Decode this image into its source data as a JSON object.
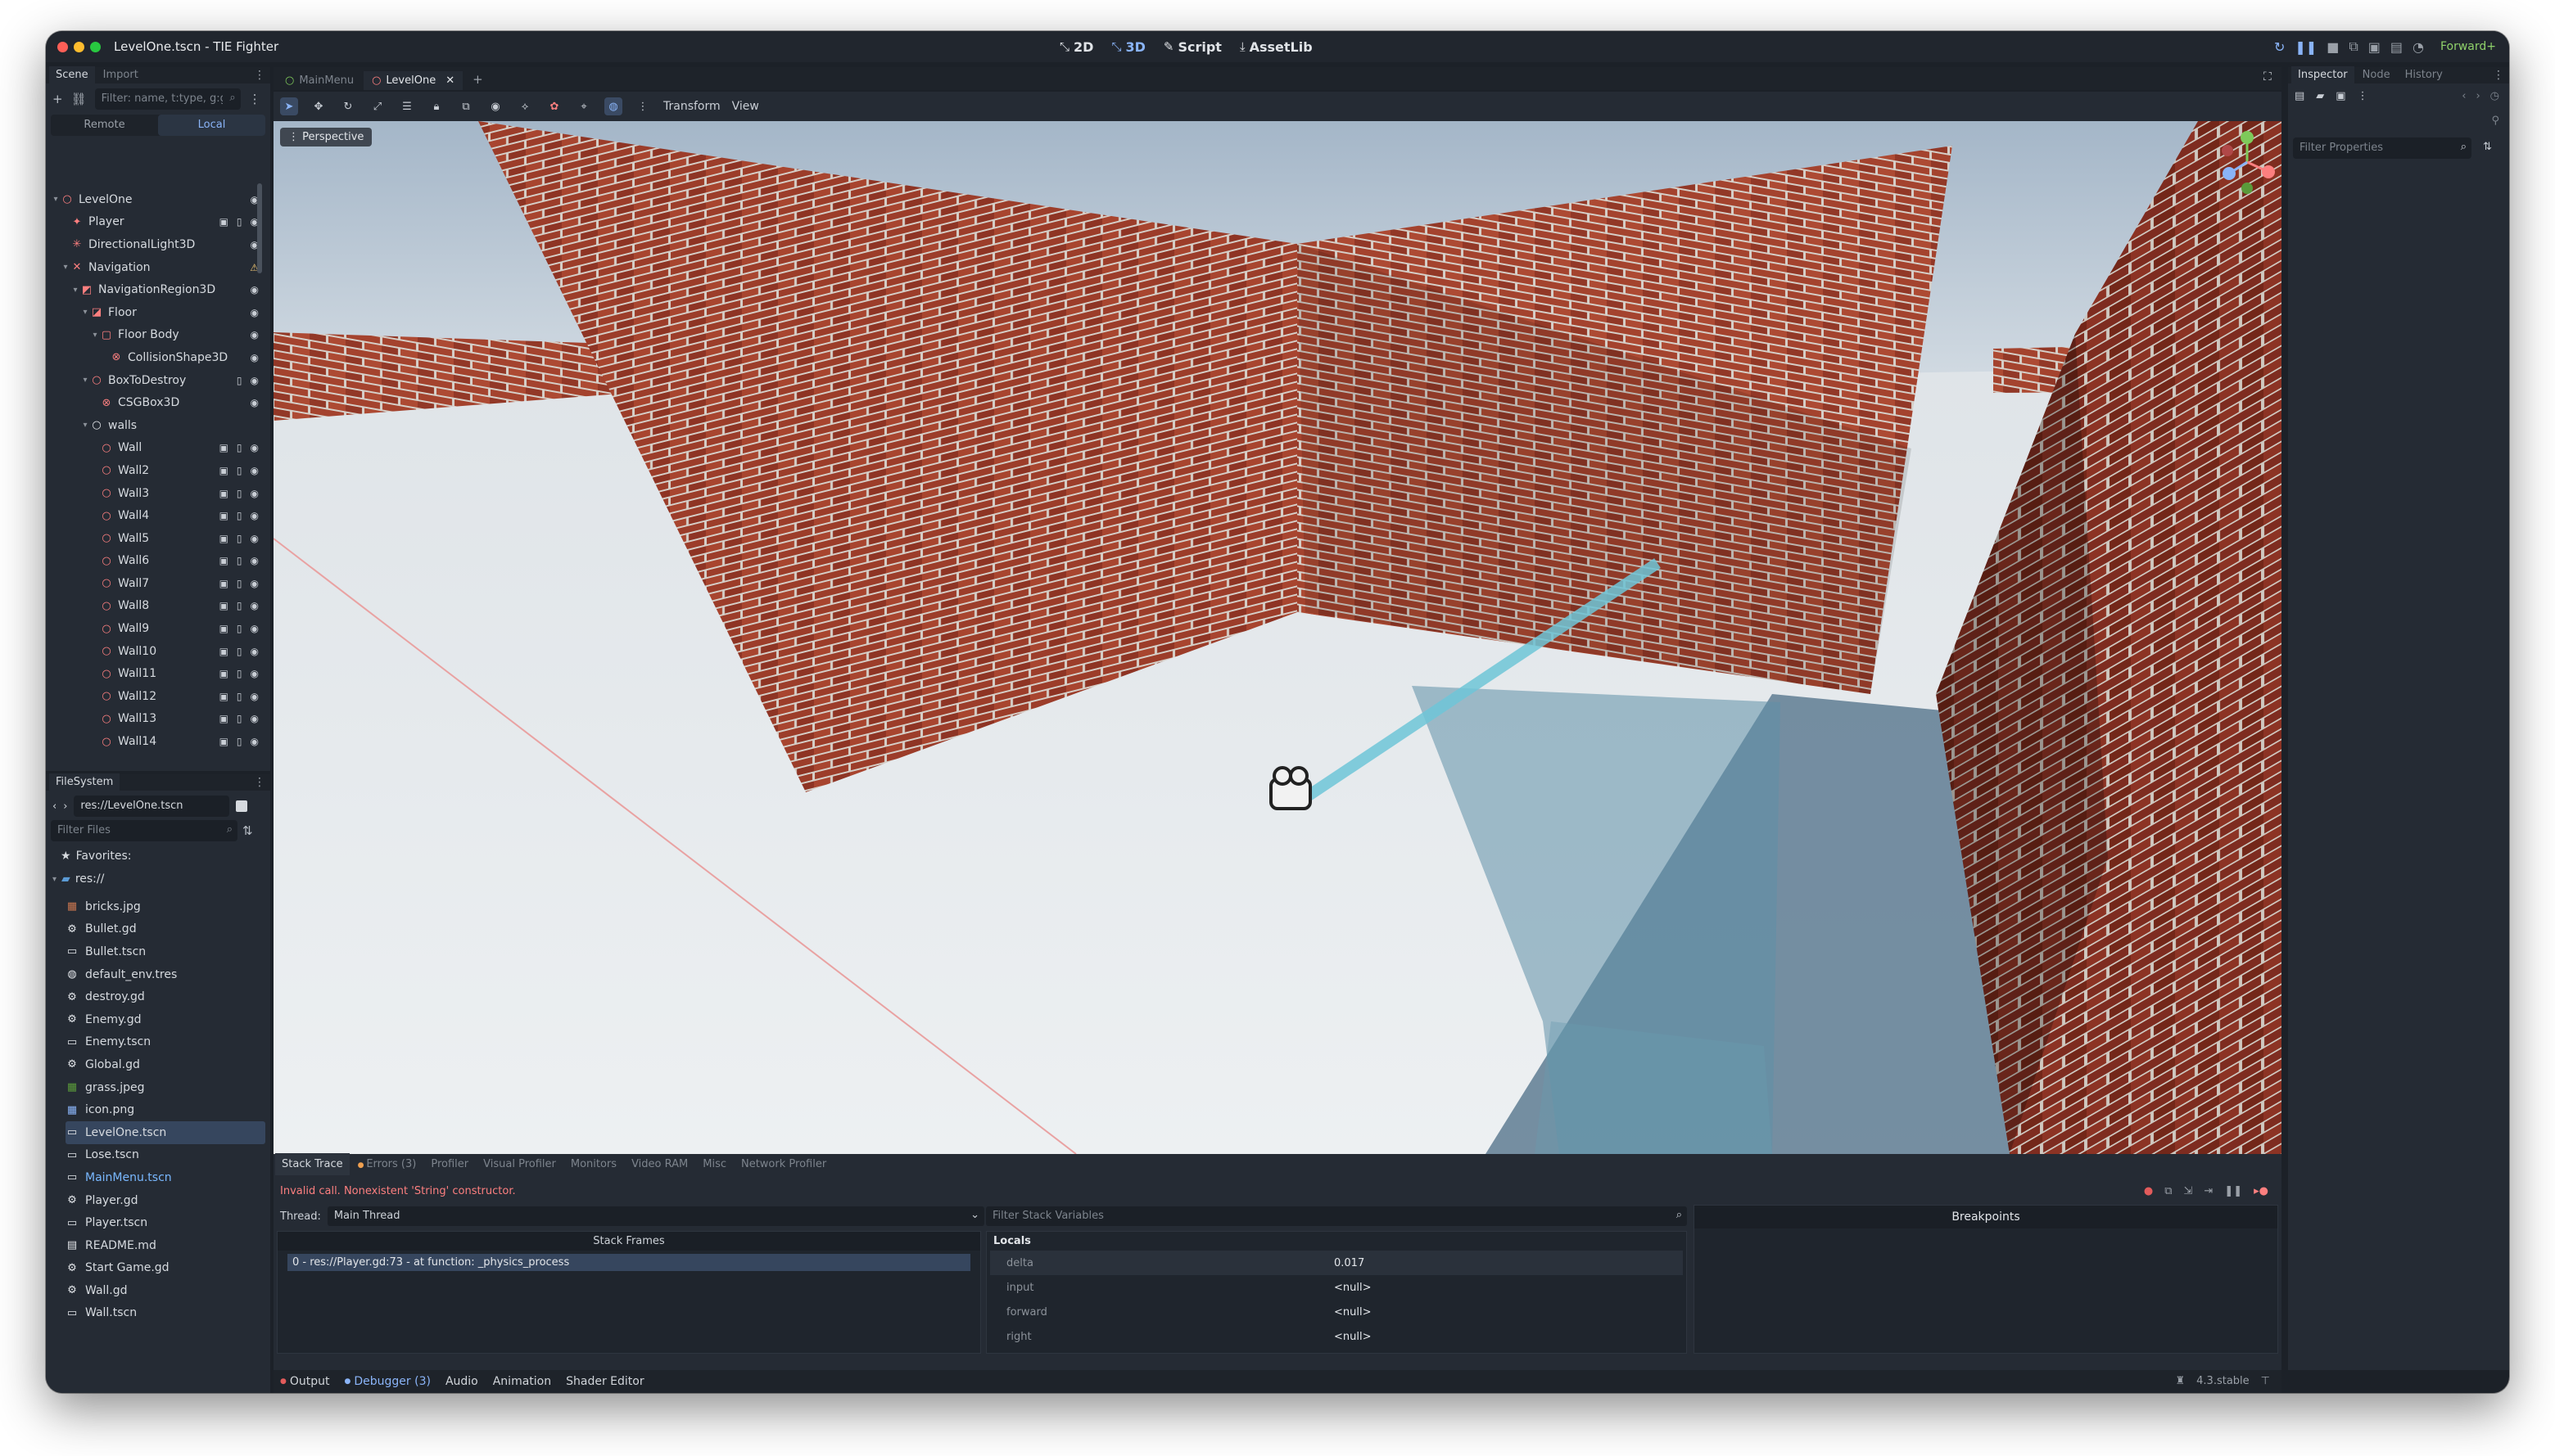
{
  "window": {
    "title": "LevelOne.tscn - TIE Fighter"
  },
  "workspaces": [
    {
      "glyph": "⤡",
      "label": "2D",
      "active": false
    },
    {
      "glyph": "⤡",
      "label": "3D",
      "active": true
    },
    {
      "glyph": "✎",
      "label": "Script",
      "active": false
    },
    {
      "glyph": "⤓",
      "label": "AssetLib",
      "active": false
    }
  ],
  "renderer": "Forward+",
  "scene_dock": {
    "tabs": [
      "Scene",
      "Import"
    ],
    "filter_placeholder": "Filter: name, t:type, g:group",
    "remote": "Remote",
    "local": "Local",
    "tree": [
      {
        "label": "LevelOne",
        "depth": 0,
        "arrow": "▾",
        "icon": "○",
        "color": "red",
        "eye": true,
        "script": false,
        "group": false,
        "warn": false
      },
      {
        "label": "Player",
        "depth": 1,
        "arrow": "",
        "icon": "✦",
        "color": "red",
        "eye": true,
        "script": true,
        "group": true,
        "warn": false
      },
      {
        "label": "DirectionalLight3D",
        "depth": 1,
        "arrow": "",
        "icon": "✳",
        "color": "red",
        "eye": true,
        "script": false,
        "group": false,
        "warn": false
      },
      {
        "label": "Navigation",
        "depth": 1,
        "arrow": "▾",
        "icon": "✕",
        "color": "red",
        "eye": false,
        "script": false,
        "group": false,
        "warn": true
      },
      {
        "label": "NavigationRegion3D",
        "depth": 2,
        "arrow": "▾",
        "icon": "◩",
        "color": "red",
        "eye": true,
        "script": false,
        "group": false,
        "warn": false
      },
      {
        "label": "Floor",
        "depth": 3,
        "arrow": "▾",
        "icon": "◪",
        "color": "red",
        "eye": true,
        "script": false,
        "group": false,
        "warn": false
      },
      {
        "label": "Floor Body",
        "depth": 4,
        "arrow": "▾",
        "icon": "▢",
        "color": "red",
        "eye": true,
        "script": false,
        "group": false,
        "warn": false
      },
      {
        "label": "CollisionShape3D",
        "depth": 5,
        "arrow": "",
        "icon": "⊗",
        "color": "red",
        "eye": true,
        "script": false,
        "group": false,
        "warn": false
      },
      {
        "label": "BoxToDestroy",
        "depth": 3,
        "arrow": "▾",
        "icon": "○",
        "color": "red",
        "eye": true,
        "script": true,
        "group": false,
        "warn": false
      },
      {
        "label": "CSGBox3D",
        "depth": 4,
        "arrow": "",
        "icon": "⊗",
        "color": "red",
        "eye": true,
        "script": false,
        "group": false,
        "warn": false
      },
      {
        "label": "walls",
        "depth": 3,
        "arrow": "▾",
        "icon": "○",
        "color": "white",
        "eye": false,
        "script": false,
        "group": false,
        "warn": false
      },
      {
        "label": "Wall",
        "depth": 4,
        "arrow": "",
        "icon": "○",
        "color": "red",
        "eye": true,
        "script": true,
        "group": true,
        "warn": false
      },
      {
        "label": "Wall2",
        "depth": 4,
        "arrow": "",
        "icon": "○",
        "color": "red",
        "eye": true,
        "script": true,
        "group": true,
        "warn": false
      },
      {
        "label": "Wall3",
        "depth": 4,
        "arrow": "",
        "icon": "○",
        "color": "red",
        "eye": true,
        "script": true,
        "group": true,
        "warn": false
      },
      {
        "label": "Wall4",
        "depth": 4,
        "arrow": "",
        "icon": "○",
        "color": "red",
        "eye": true,
        "script": true,
        "group": true,
        "warn": false
      },
      {
        "label": "Wall5",
        "depth": 4,
        "arrow": "",
        "icon": "○",
        "color": "red",
        "eye": true,
        "script": true,
        "group": true,
        "warn": false
      },
      {
        "label": "Wall6",
        "depth": 4,
        "arrow": "",
        "icon": "○",
        "color": "red",
        "eye": true,
        "script": true,
        "group": true,
        "warn": false
      },
      {
        "label": "Wall7",
        "depth": 4,
        "arrow": "",
        "icon": "○",
        "color": "red",
        "eye": true,
        "script": true,
        "group": true,
        "warn": false
      },
      {
        "label": "Wall8",
        "depth": 4,
        "arrow": "",
        "icon": "○",
        "color": "red",
        "eye": true,
        "script": true,
        "group": true,
        "warn": false
      },
      {
        "label": "Wall9",
        "depth": 4,
        "arrow": "",
        "icon": "○",
        "color": "red",
        "eye": true,
        "script": true,
        "group": true,
        "warn": false
      },
      {
        "label": "Wall10",
        "depth": 4,
        "arrow": "",
        "icon": "○",
        "color": "red",
        "eye": true,
        "script": true,
        "group": true,
        "warn": false
      },
      {
        "label": "Wall11",
        "depth": 4,
        "arrow": "",
        "icon": "○",
        "color": "red",
        "eye": true,
        "script": true,
        "group": true,
        "warn": false
      },
      {
        "label": "Wall12",
        "depth": 4,
        "arrow": "",
        "icon": "○",
        "color": "red",
        "eye": true,
        "script": true,
        "group": true,
        "warn": false
      },
      {
        "label": "Wall13",
        "depth": 4,
        "arrow": "",
        "icon": "○",
        "color": "red",
        "eye": true,
        "script": true,
        "group": true,
        "warn": false
      },
      {
        "label": "Wall14",
        "depth": 4,
        "arrow": "",
        "icon": "○",
        "color": "red",
        "eye": true,
        "script": true,
        "group": true,
        "warn": false
      }
    ]
  },
  "filesystem": {
    "title": "FileSystem",
    "path": "res://LevelOne.tscn",
    "filter_placeholder": "Filter Files",
    "favorites": "Favorites:",
    "root": "res://",
    "files": [
      {
        "name": "bricks.jpg",
        "icon": "▦",
        "color": "#c9764f"
      },
      {
        "name": "Bullet.gd",
        "icon": "⚙",
        "color": "#e2e5e9"
      },
      {
        "name": "Bullet.tscn",
        "icon": "▭",
        "color": "#e2e5e9"
      },
      {
        "name": "default_env.tres",
        "icon": "◍",
        "color": "#e2e5e9"
      },
      {
        "name": "destroy.gd",
        "icon": "⚙",
        "color": "#e2e5e9"
      },
      {
        "name": "Enemy.gd",
        "icon": "⚙",
        "color": "#e2e5e9"
      },
      {
        "name": "Enemy.tscn",
        "icon": "▭",
        "color": "#e2e5e9"
      },
      {
        "name": "Global.gd",
        "icon": "⚙",
        "color": "#e2e5e9"
      },
      {
        "name": "grass.jpeg",
        "icon": "▦",
        "color": "#5a9a3a"
      },
      {
        "name": "icon.png",
        "icon": "▦",
        "color": "#8ab4f8"
      },
      {
        "name": "LevelOne.tscn",
        "icon": "▭",
        "color": "#e2e5e9",
        "selected": true
      },
      {
        "name": "Lose.tscn",
        "icon": "▭",
        "color": "#e2e5e9"
      },
      {
        "name": "MainMenu.tscn",
        "icon": "▭",
        "color": "#e2e5e9",
        "blue": true
      },
      {
        "name": "Player.gd",
        "icon": "⚙",
        "color": "#e2e5e9"
      },
      {
        "name": "Player.tscn",
        "icon": "▭",
        "color": "#e2e5e9"
      },
      {
        "name": "README.md",
        "icon": "▤",
        "color": "#e2e5e9"
      },
      {
        "name": "Start Game.gd",
        "icon": "⚙",
        "color": "#e2e5e9"
      },
      {
        "name": "Wall.gd",
        "icon": "⚙",
        "color": "#e2e5e9"
      },
      {
        "name": "Wall.tscn",
        "icon": "▭",
        "color": "#e2e5e9"
      }
    ]
  },
  "scene_tabs": [
    {
      "label": "MainMenu",
      "active": false
    },
    {
      "label": "LevelOne",
      "active": true
    }
  ],
  "viewport": {
    "menu_transform": "Transform",
    "menu_view": "View",
    "perspective": "Perspective"
  },
  "debugger": {
    "tabs": [
      "Stack Trace",
      "Errors (3)",
      "Profiler",
      "Visual Profiler",
      "Monitors",
      "Video RAM",
      "Misc",
      "Network Profiler"
    ],
    "error": "Invalid call. Nonexistent 'String' constructor.",
    "thread_label": "Thread:",
    "thread": "Main Thread",
    "stack_frames_title": "Stack Frames",
    "frame": "0 - res://Player.gd:73 - at function: _physics_process",
    "filter_vars_placeholder": "Filter Stack Variables",
    "locals": "Locals",
    "vars": [
      {
        "name": "delta",
        "value": "0.017"
      },
      {
        "name": "input",
        "value": "<null>"
      },
      {
        "name": "forward",
        "value": "<null>"
      },
      {
        "name": "right",
        "value": "<null>"
      }
    ],
    "breakpoints": "Breakpoints"
  },
  "bottom_bar": {
    "tabs": [
      "Output",
      "Debugger (3)",
      "Audio",
      "Animation",
      "Shader Editor"
    ],
    "version": "4.3.stable"
  },
  "inspector": {
    "tabs": [
      "Inspector",
      "Node",
      "History"
    ],
    "filter_placeholder": "Filter Properties"
  }
}
